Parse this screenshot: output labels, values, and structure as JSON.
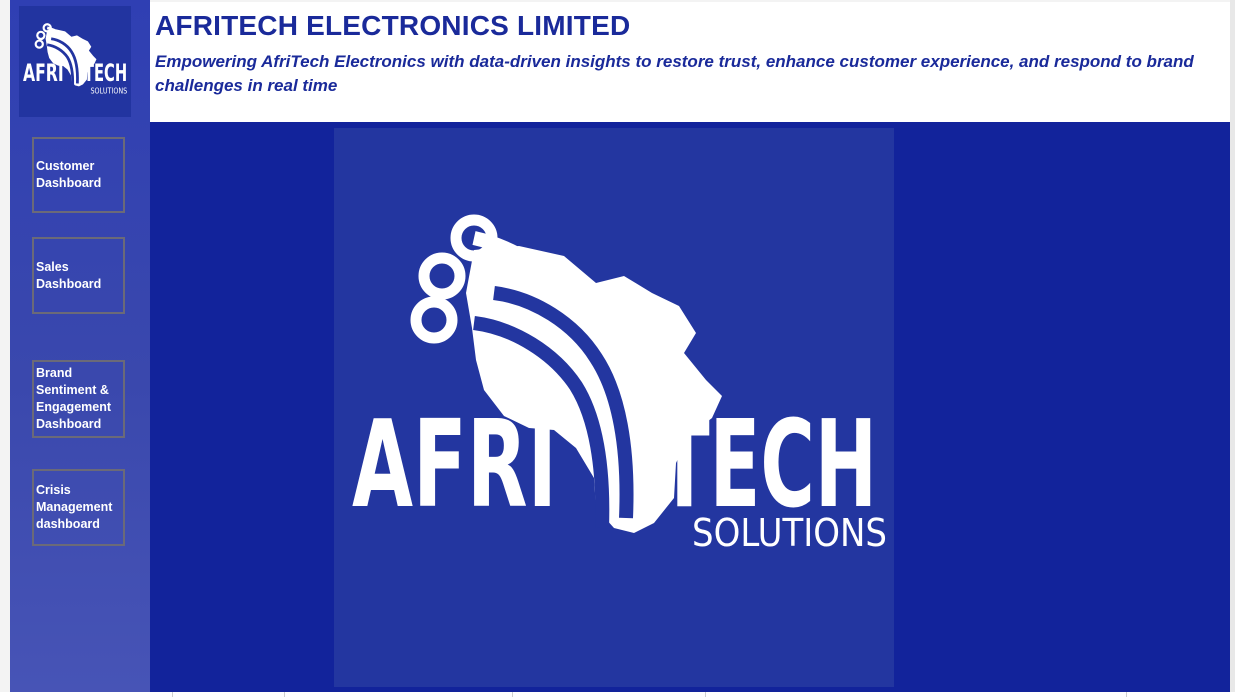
{
  "header": {
    "title": "AFRITECH ELECTRONICS LIMITED",
    "subtitle": "Empowering AfriTech Electronics with data-driven insights to restore trust, enhance customer experience, and respond to brand challenges in real time"
  },
  "nav": {
    "customer": "Customer Dashboard",
    "sales": "Sales Dashboard",
    "brand": "Brand Sentiment & Engagement Dashboard",
    "crisis": "Crisis Management dashboard"
  },
  "logo": {
    "word_left": "AFRI",
    "word_right": "TECH",
    "tagline": "SOLUTIONS",
    "icon": "africa-circuit-icon"
  },
  "colors": {
    "header_text": "#1a2a9a",
    "main_bg": "#12239b",
    "logo_bg": "#2336a0",
    "sidebar_bg": "#3a48ad",
    "nav_border": "#6b6a78"
  }
}
